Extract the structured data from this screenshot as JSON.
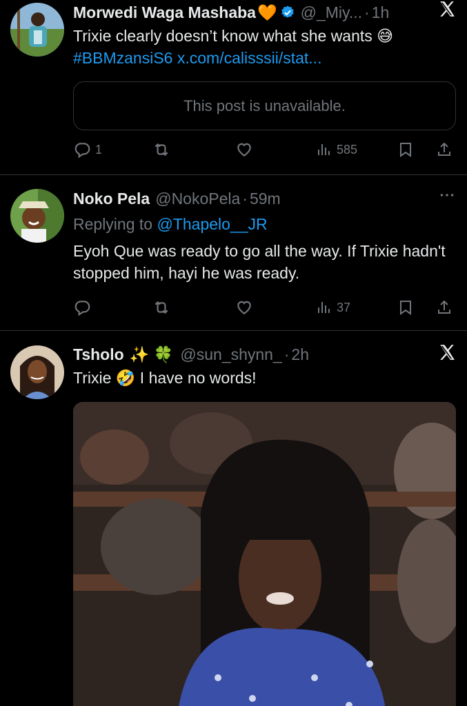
{
  "posts": [
    {
      "name": "Morwedi Waga Mashaba",
      "name_emoji": "🧡",
      "handle": "@_Miy...",
      "dot": "·",
      "time": "1h",
      "text": "Trixie clearly doesn’t know what she wants 😅",
      "hashtag": "#BBMzansiS6",
      "link": "x.com/calisssii/stat...",
      "quote_text": "This post is unavailable.",
      "replies": "1",
      "views": "585"
    },
    {
      "name": "Noko Pela",
      "handle": "@NokoPela",
      "dot": "·",
      "time": "59m",
      "reply_prefix": "Replying to",
      "reply_to": "@Thapelo__JR",
      "text": "Eyoh Que was ready to go all the way. If Trixie hadn't stopped him, hayi he was ready.",
      "views": "37"
    },
    {
      "name": "Tsholo",
      "name_emoji": "✨ 🍀",
      "handle": "@sun_shynn_",
      "dot": "·",
      "time": "2h",
      "text": "Trixie 🤣 I have no words!"
    }
  ],
  "icons": {
    "close": "x-logo-icon",
    "more": "more-icon",
    "reply": "reply-icon",
    "retweet": "retweet-icon",
    "like": "like-icon",
    "views": "views-icon",
    "bookmark": "bookmark-icon",
    "share": "share-icon",
    "verified": "verified-badge-icon"
  },
  "colors": {
    "background": "#000000",
    "text": "#e7e9ea",
    "muted": "#71767b",
    "link": "#1d9bf0",
    "divider": "#2f3336",
    "verified": "#1d9bf0"
  }
}
